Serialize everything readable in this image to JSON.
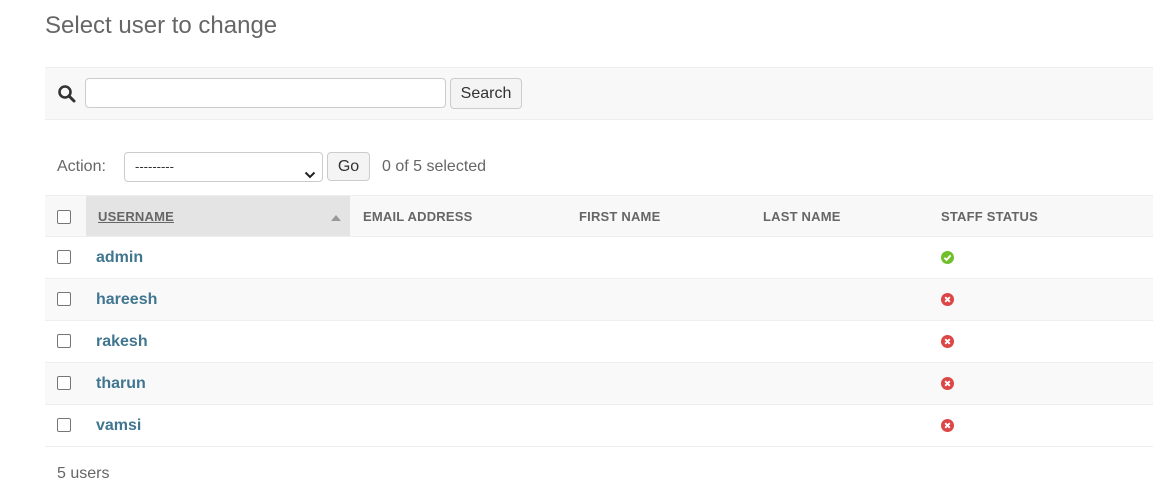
{
  "page": {
    "title": "Select user to change"
  },
  "search": {
    "value": "",
    "placeholder": "",
    "button_label": "Search"
  },
  "actions": {
    "label": "Action:",
    "selected_option": "---------",
    "go_label": "Go",
    "selection_counter": "0 of 5 selected"
  },
  "table": {
    "columns": [
      "USERNAME",
      "EMAIL ADDRESS",
      "FIRST NAME",
      "LAST NAME",
      "STAFF STATUS"
    ],
    "sorted_column": "USERNAME",
    "rows": [
      {
        "username": "admin",
        "email": "",
        "first_name": "",
        "last_name": "",
        "staff_status": true,
        "status_icon": "check-circle-icon"
      },
      {
        "username": "hareesh",
        "email": "",
        "first_name": "",
        "last_name": "",
        "staff_status": false,
        "status_icon": "x-circle-icon"
      },
      {
        "username": "rakesh",
        "email": "",
        "first_name": "",
        "last_name": "",
        "staff_status": false,
        "status_icon": "x-circle-icon"
      },
      {
        "username": "tharun",
        "email": "",
        "first_name": "",
        "last_name": "",
        "staff_status": false,
        "status_icon": "x-circle-icon"
      },
      {
        "username": "vamsi",
        "email": "",
        "first_name": "",
        "last_name": "",
        "staff_status": false,
        "status_icon": "x-circle-icon"
      }
    ]
  },
  "footer": {
    "count_text": "5 users"
  },
  "colors": {
    "link": "#417690",
    "yes": "#70bf2b",
    "no": "#dd4646",
    "header_bg": "#f8f8f8",
    "sorted_header_bg": "#e4e4e4"
  }
}
